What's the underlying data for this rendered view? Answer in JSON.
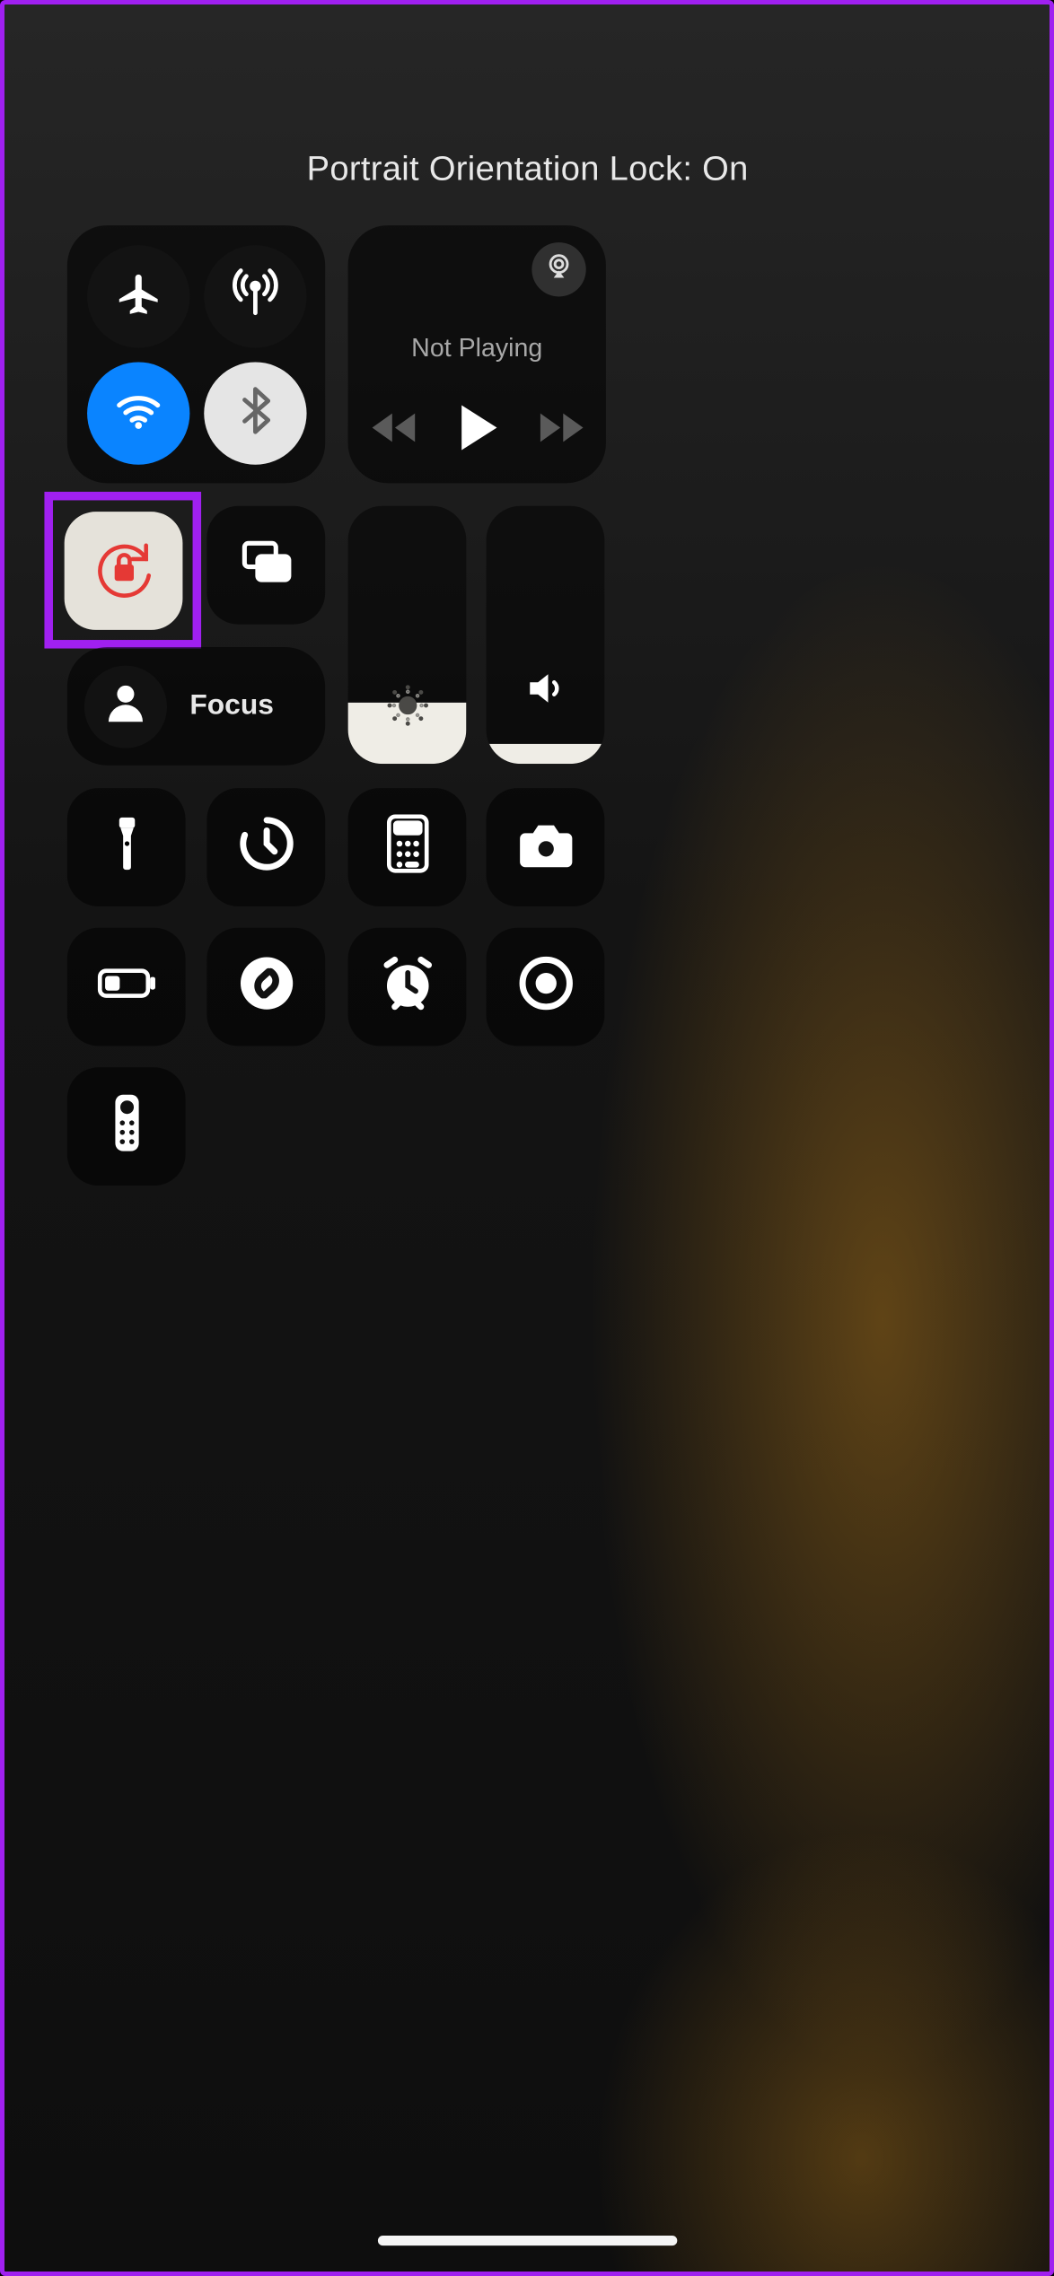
{
  "status_title": "Portrait Orientation Lock: On",
  "connectivity": {
    "airplane": {
      "on": false,
      "icon": "airplane-icon"
    },
    "cellular": {
      "on": false,
      "icon": "antenna-icon"
    },
    "wifi": {
      "on": true,
      "icon": "wifi-icon",
      "color": "#0a84ff"
    },
    "bluetooth": {
      "on": true,
      "icon": "bluetooth-icon",
      "color": "#e5e5e5"
    }
  },
  "media": {
    "now_playing": "Not Playing",
    "airplay_icon": "airplay-icon",
    "back_icon": "rewind-icon",
    "play_icon": "play-icon",
    "forward_icon": "fastforward-icon"
  },
  "orientation_lock": {
    "on": true,
    "icon": "orientation-lock-icon",
    "highlight": true
  },
  "screen_mirroring": {
    "icon": "rectangles-icon"
  },
  "focus": {
    "label": "Focus",
    "icon": "person-icon"
  },
  "brightness": {
    "percent": 24,
    "icon": "sun-icon"
  },
  "volume": {
    "percent": 8,
    "icon": "speaker-icon"
  },
  "tiles": {
    "flashlight": "flashlight-icon",
    "timer": "timer-icon",
    "calculator": "calculator-icon",
    "camera": "camera-icon",
    "low_power": "battery-icon",
    "shazam": "shazam-icon",
    "alarm": "alarm-icon",
    "screen_record": "record-icon",
    "remote": "apple-tv-remote-icon"
  },
  "colors": {
    "highlight_border": "#a020f0",
    "orientation_lock_red": "#e53935",
    "warm_halo": "rgba(240,160,30,0.35)"
  }
}
